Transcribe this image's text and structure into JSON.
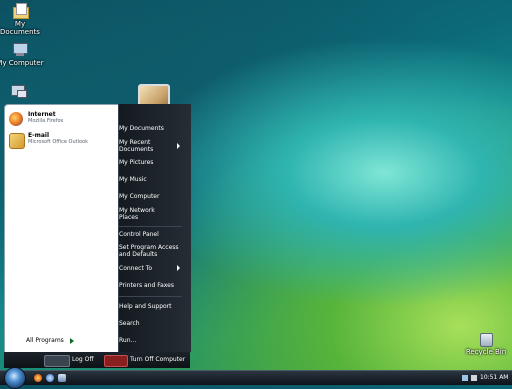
{
  "desktop": {
    "icons": [
      {
        "label": "My\nDocuments",
        "icon": "folder-icon"
      },
      {
        "label": "My Computer",
        "icon": "computer-icon"
      },
      {
        "label": "My Network",
        "icon": "network-icon"
      },
      {
        "label": "Recycle Bin",
        "icon": "recycle-bin-icon"
      }
    ]
  },
  "start_menu": {
    "pinned": [
      {
        "title": "Internet",
        "subtitle": "Mozilla Firefox",
        "icon": "firefox-icon",
        "color": "#e8731c"
      },
      {
        "title": "E-mail",
        "subtitle": "Microsoft Office Outlook",
        "icon": "outlook-icon",
        "color": "#e5b64a"
      }
    ],
    "all_programs": "All Programs",
    "right_items": [
      {
        "label": "My Documents"
      },
      {
        "label": "My Recent\nDocuments",
        "arrow": true
      },
      {
        "label": "My Pictures"
      },
      {
        "label": "My Music"
      },
      {
        "label": "My Computer"
      },
      {
        "label": "My Network\nPlaces"
      },
      {
        "label": "Control Panel"
      },
      {
        "label": "Set Program Access\nand Defaults"
      },
      {
        "label": "Connect To",
        "arrow": true
      },
      {
        "label": "Printers and Faxes"
      },
      {
        "label": "Help and Support"
      },
      {
        "label": "Search"
      },
      {
        "label": "Run..."
      }
    ],
    "log_off": "Log Off",
    "turn_off": "Turn Off Computer"
  },
  "taskbar": {
    "clock": "10:51 AM",
    "quick_launch": [
      "firefox-icon",
      "ie-icon",
      "show-desktop-icon"
    ],
    "tray": [
      "network-tray-icon",
      "volume-tray-icon"
    ]
  },
  "colors": {
    "start_menu_right": "#1c242c",
    "start_menu_left": "#ffffff",
    "turn_off": "#8a1f1f"
  }
}
